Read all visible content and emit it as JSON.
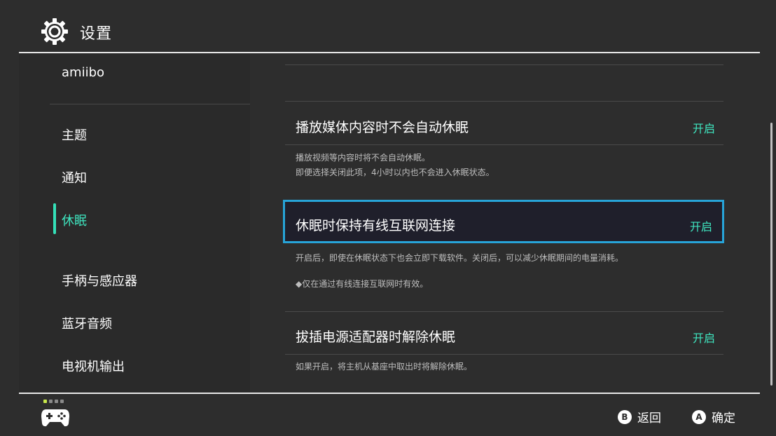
{
  "header": {
    "icon": "gear-icon",
    "title": "设置"
  },
  "sidebar": {
    "items": [
      {
        "label": "amiibo"
      },
      {
        "label": "主题"
      },
      {
        "label": "通知"
      },
      {
        "label": "休眠",
        "active": true
      },
      {
        "label": "手柄与感应器"
      },
      {
        "label": "蓝牙音频"
      },
      {
        "label": "电视机输出"
      }
    ],
    "active_color": "#3fe6c0"
  },
  "settings": [
    {
      "title": "播放媒体内容时不会自动休眠",
      "value": "开启",
      "desc_line1": "播放视频等内容时将不会自动休眠。",
      "desc_line2": "即便选择关闭此项，4小时以内也不会进入休眠状态。"
    },
    {
      "title": "休眠时保持有线互联网连接",
      "value": "开启",
      "focused": true,
      "desc_line1": "开启后，即使在休眠状态下也会立即下载软件。关闭后，可以减少休眠期间的电量消耗。",
      "desc_line2": "◆仅在通过有线连接互联网时有效。"
    },
    {
      "title": "拔插电源适配器时解除休眠",
      "value": "开启",
      "desc_line1": "如果开启，将主机从基座中取出时将解除休眠。"
    }
  ],
  "footer": {
    "controller_icon": "controller-icon",
    "back": {
      "key": "B",
      "label": "返回"
    },
    "confirm": {
      "key": "A",
      "label": "确定"
    }
  },
  "colors": {
    "background": "#2d2d2d",
    "accent": "#3fe6c0",
    "focus_border": "#27a4d8"
  }
}
